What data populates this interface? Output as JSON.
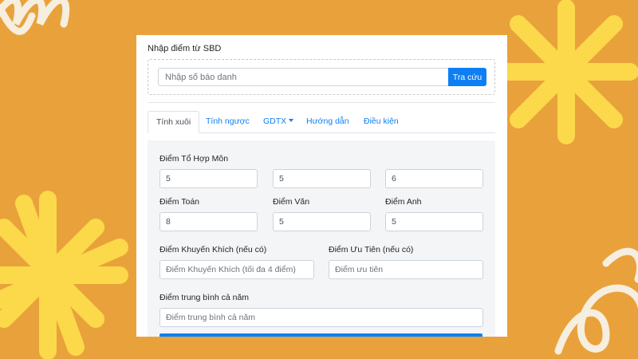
{
  "lookup": {
    "label": "Nhập điểm từ SBD",
    "placeholder": "Nhập số báo danh",
    "button": "Tra cứu"
  },
  "tabs": [
    {
      "label": "Tính xuôi",
      "active": true
    },
    {
      "label": "Tính ngược",
      "active": false
    },
    {
      "label": "GDTX",
      "active": false,
      "dropdown": true
    },
    {
      "label": "Hướng dẫn",
      "active": false
    },
    {
      "label": "Điều kiện",
      "active": false
    }
  ],
  "form": {
    "combo_label": "Điểm Tổ Hợp Môn",
    "combo_values": [
      "5",
      "5",
      "6"
    ],
    "math_label": "Điểm Toán",
    "math_value": "8",
    "literature_label": "Điểm Văn",
    "literature_value": "5",
    "english_label": "Điểm Anh",
    "english_value": "5",
    "bonus_label": "Điểm Khuyến Khích (nếu có)",
    "bonus_placeholder": "Điểm Khuyến Khích (tối đa 4 điểm)",
    "priority_label": "Điểm Ưu Tiên (nếu có)",
    "priority_placeholder": "Điểm ưu tiên",
    "gpa_label": "Điểm trung bình cả năm",
    "gpa_placeholder": "Điểm trung bình cả năm"
  },
  "colors": {
    "background": "#e9a23b",
    "decoration": "#fbd94a",
    "accent": "#0d7ff5"
  }
}
